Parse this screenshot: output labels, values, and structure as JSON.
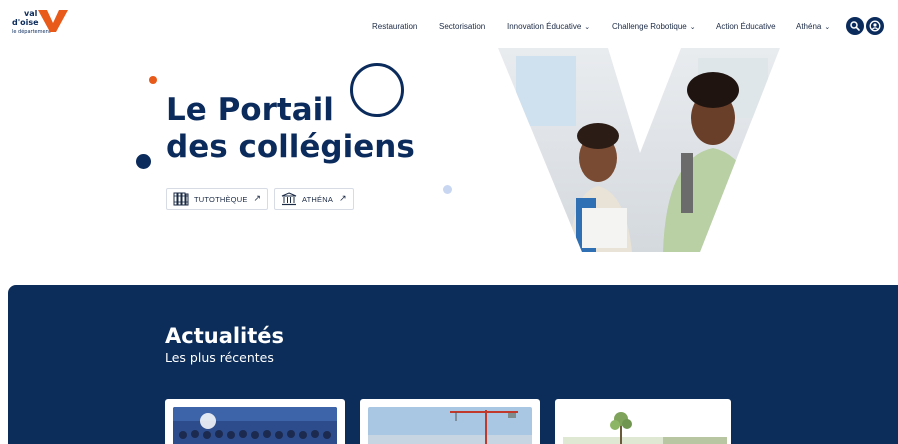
{
  "logo": {
    "line1": "val",
    "line2": "d'oise",
    "line3": "le département",
    "brand_color": "#E85A1A"
  },
  "nav": {
    "items": [
      {
        "label": "Restauration",
        "has_dropdown": false
      },
      {
        "label": "Sectorisation",
        "has_dropdown": false
      },
      {
        "label": "Innovation Éducative",
        "has_dropdown": true
      },
      {
        "label": "Challenge Robotique",
        "has_dropdown": true
      },
      {
        "label": "Action Éducative",
        "has_dropdown": false
      },
      {
        "label": "Athéna",
        "has_dropdown": true
      }
    ],
    "chevron": "⌄",
    "search_icon": "search-icon",
    "account_icon": "user-circle-icon"
  },
  "hero": {
    "title_line1": "Le Portail",
    "title_line2": "des collégiens",
    "buttons": [
      {
        "label": "TUTOTHÈQUE",
        "icon": "books-icon",
        "arrow": "↗"
      },
      {
        "label": "ATHÉNA",
        "icon": "temple-icon",
        "arrow": "↗"
      }
    ]
  },
  "news": {
    "title": "Actualités",
    "subtitle": "Les plus récentes",
    "cards": [
      {
        "image": "group-photo"
      },
      {
        "image": "construction-crane-photo"
      },
      {
        "image": "tree-photo"
      }
    ]
  },
  "colors": {
    "navy": "#0B2B5C",
    "orange": "#E85A1A",
    "section_bg": "#0C2D5A"
  }
}
